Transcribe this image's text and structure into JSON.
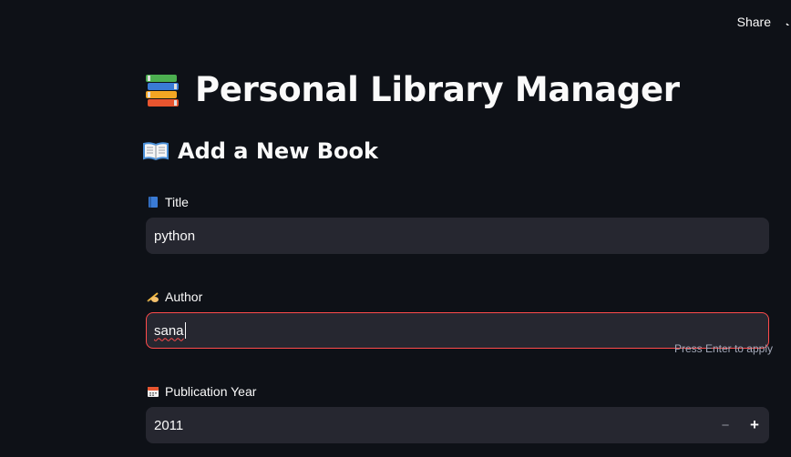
{
  "header": {
    "share_label": "Share"
  },
  "page": {
    "title": "Personal Library Manager",
    "title_icon": "books-icon",
    "section_title": "Add a New Book",
    "section_icon": "open-book-icon"
  },
  "form": {
    "title_field": {
      "label": "Title",
      "icon": "blue-book-icon",
      "value": "python"
    },
    "author_field": {
      "label": "Author",
      "icon": "writing-hand-icon",
      "value": "sana",
      "hint": "Press Enter to apply"
    },
    "year_field": {
      "label": "Publication Year",
      "icon": "calendar-icon",
      "value": "2011",
      "decrement_label": "−",
      "increment_label": "+"
    }
  },
  "colors": {
    "background": "#0e1117",
    "input_bg": "#262730",
    "focus_border": "#ff4b4b",
    "text": "#fafafa",
    "hint": "#a3a8b8"
  }
}
